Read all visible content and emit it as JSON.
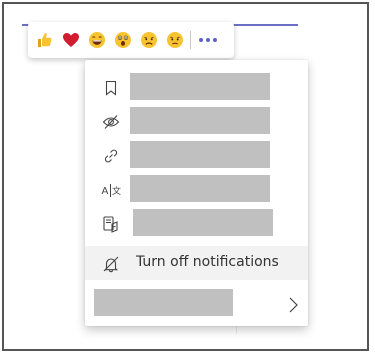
{
  "reactions": [
    {
      "name": "like",
      "icon": "thumbs-up-icon"
    },
    {
      "name": "heart",
      "icon": "heart-icon"
    },
    {
      "name": "laugh",
      "icon": "laughing-face-icon"
    },
    {
      "name": "surprised",
      "icon": "surprised-face-icon"
    },
    {
      "name": "sad",
      "icon": "sad-face-icon"
    },
    {
      "name": "angry",
      "icon": "angry-face-icon"
    }
  ],
  "more_options_icon": "ellipsis-icon",
  "menu": {
    "items": [
      {
        "icon": "bookmark-icon",
        "label": ""
      },
      {
        "icon": "eye-off-icon",
        "label": ""
      },
      {
        "icon": "link-icon",
        "label": ""
      },
      {
        "icon": "translate-icon",
        "label": ""
      },
      {
        "icon": "immersive-reader-icon",
        "label": ""
      },
      {
        "icon": "bell-off-icon",
        "label": "Turn off notifications"
      },
      {
        "icon": "chevron-right-icon",
        "label": ""
      }
    ]
  },
  "colors": {
    "accent": "#6b70c6",
    "heart": "#d11d2f",
    "emoji": "#f7c331",
    "placeholder": "#c0c0c0",
    "hover": "#f2f2f2"
  }
}
